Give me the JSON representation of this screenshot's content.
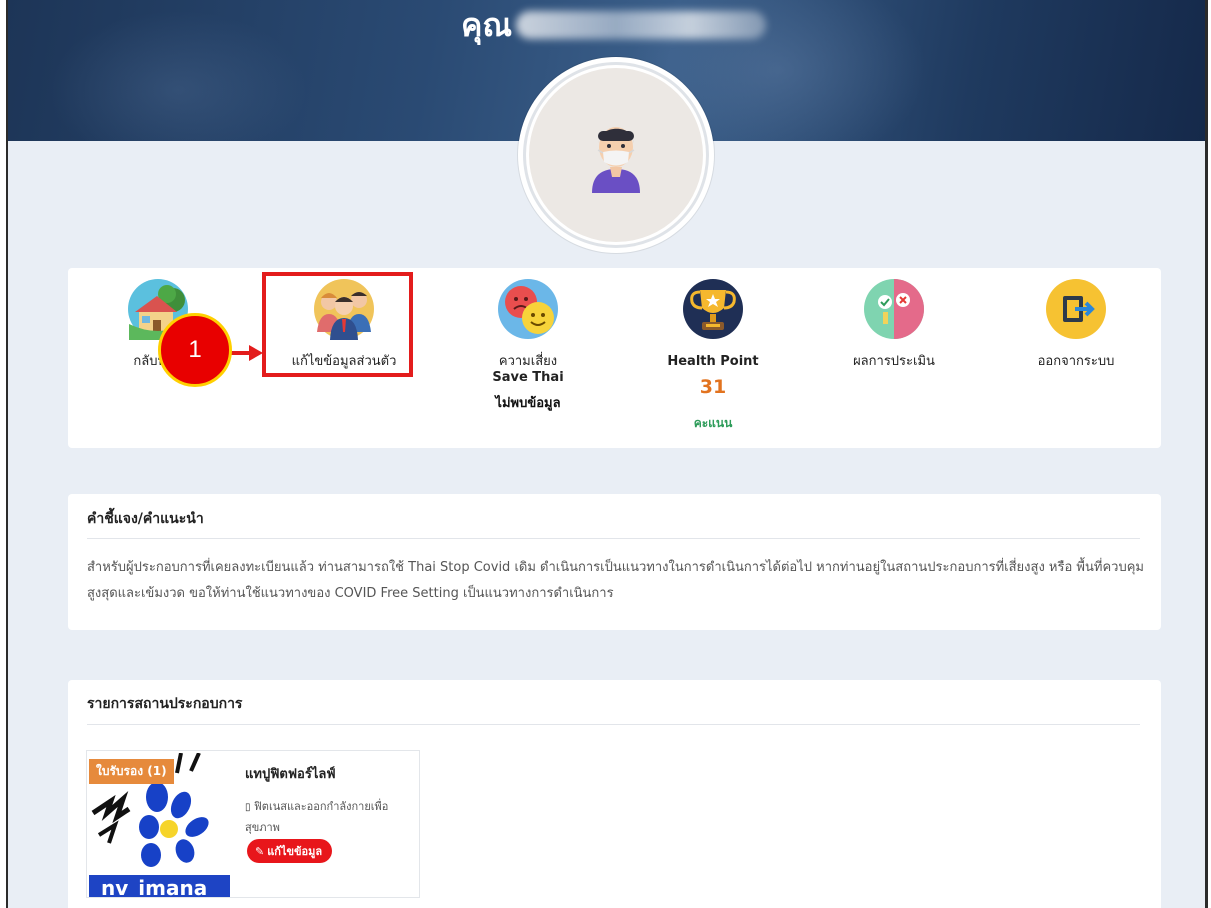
{
  "profile": {
    "honorific": "คุณ"
  },
  "menu": {
    "items": [
      {
        "label": "กลับหน้าหลัก",
        "icon": "home-icon"
      },
      {
        "label": "แก้ไขข้อมูลส่วนตัว",
        "icon": "users-icon"
      },
      {
        "label": "ความเสี่ยง",
        "sublabel": "Save Thai",
        "status": "ไม่พบข้อมูล",
        "icon": "risk-faces-icon"
      },
      {
        "label": "Health Point",
        "value": "31",
        "unit": "คะแนน",
        "icon": "trophy-icon"
      },
      {
        "label": "ผลการประเมิน",
        "icon": "evaluation-icon"
      },
      {
        "label": "ออกจากระบบ",
        "icon": "logout-icon"
      }
    ]
  },
  "annotation": {
    "step_number": "1"
  },
  "instructions": {
    "title": "คำชี้แจง/คำแนะนำ",
    "body": "สำหรับผู้ประกอบการที่เคยลงทะเบียนแล้ว ท่านสามารถใช้ Thai Stop Covid เดิม ดำเนินการเป็นแนวทางในการดำเนินการได้ต่อไป หากท่านอยู่ในสถานประกอบการที่เสี่ยงสูง หรือ พื้นที่ควบคุมสูงสุดและเข้มงวด ขอให้ท่านใช้แนวทางของ COVID Free Setting เป็นแนวทางการดำเนินการ"
  },
  "business_list": {
    "title": "รายการสถานประกอบการ",
    "items": [
      {
        "badge": "ใบรับรอง (1)",
        "name": "แทปูฟิตฟอร์ไลฟ์",
        "category": "ฟิตเนสและออกกำลังกายเพื่อสุขภาพ",
        "edit_label": "แก้ไขข้อมูล",
        "thumb_text": "nv_imana"
      }
    ]
  },
  "colors": {
    "banner": "#1d3557",
    "page_bg": "#e9eef5",
    "highlight": "#e31c1c",
    "points": "#e2731f",
    "unit": "#2e9c5a",
    "edit_button": "#e8161b",
    "badge": "#e68a3c"
  }
}
